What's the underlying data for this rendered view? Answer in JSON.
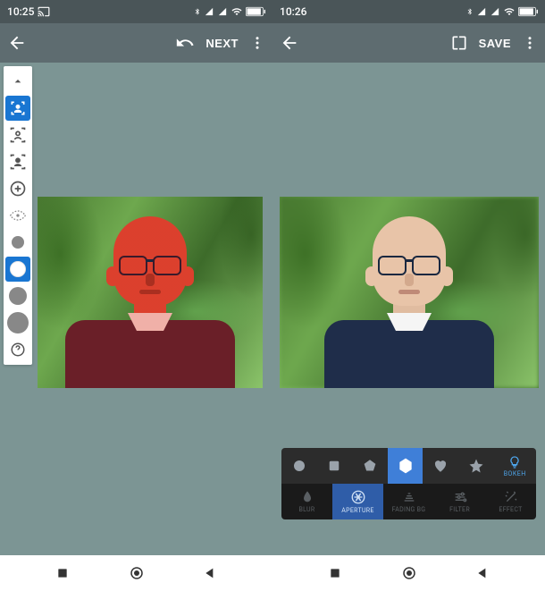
{
  "screen1": {
    "status": {
      "time": "10:25"
    },
    "appbar": {
      "next_label": "NEXT"
    },
    "toolbar": {
      "items": [
        {
          "name": "chevron-up-icon"
        },
        {
          "name": "portrait-detect-icon",
          "selected": true
        },
        {
          "name": "person-add-icon"
        },
        {
          "name": "person-remove-icon"
        },
        {
          "name": "add-circle-icon"
        },
        {
          "name": "eye-icon"
        },
        {
          "name": "brush-small-icon"
        },
        {
          "name": "brush-medium-icon",
          "selected": true
        },
        {
          "name": "brush-large-icon"
        },
        {
          "name": "brush-xl-icon"
        },
        {
          "name": "help-icon"
        }
      ]
    }
  },
  "screen2": {
    "status": {
      "time": "10:26"
    },
    "appbar": {
      "save_label": "SAVE"
    },
    "shapes": [
      {
        "name": "circle-shape"
      },
      {
        "name": "square-shape"
      },
      {
        "name": "pentagon-shape"
      },
      {
        "name": "hexagon-shape",
        "selected": true
      },
      {
        "name": "heart-shape"
      },
      {
        "name": "star-shape"
      }
    ],
    "shapes_bokeh_label": "BOKEH",
    "modes": [
      {
        "name": "blur-mode",
        "label": "BLUR"
      },
      {
        "name": "aperture-mode",
        "label": "APERTURE",
        "selected": true
      },
      {
        "name": "fading-bg-mode",
        "label": "FADING BG"
      },
      {
        "name": "filter-mode",
        "label": "FILTER"
      },
      {
        "name": "effect-mode",
        "label": "EFFECT"
      }
    ]
  }
}
